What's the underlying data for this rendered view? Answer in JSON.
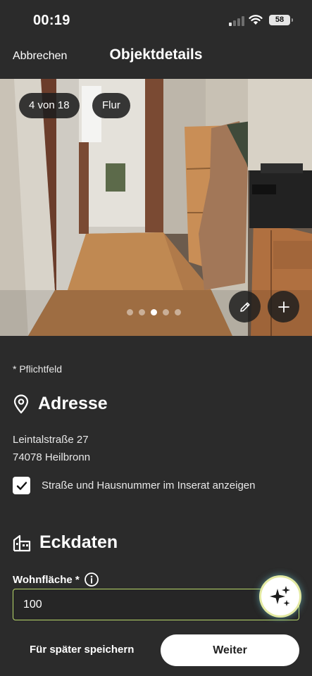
{
  "status_bar": {
    "time": "00:19",
    "battery": "58"
  },
  "nav": {
    "cancel_label": "Abbrechen",
    "title": "Objektdetails"
  },
  "photo": {
    "position_chip": "4 von 18",
    "room_chip": "Flur",
    "current_index": 4,
    "total": 18,
    "visible_dots": 5,
    "active_dot": 3
  },
  "form": {
    "required_note": "* Pflichtfeld",
    "address_section": {
      "title": "Adresse",
      "street": "Leintalstraße 27",
      "city": "74078 Heilbronn",
      "show_address_label": "Straße und Hausnummer im Inserat anzeigen",
      "show_address_checked": true
    },
    "facts_section": {
      "title": "Eckdaten",
      "living_area_label": "Wohnfläche *",
      "living_area_value": "100"
    }
  },
  "footer": {
    "save_later_label": "Für später speichern",
    "next_label": "Weiter"
  },
  "colors": {
    "background": "#2b2b2b",
    "input_border": "#b9d96a",
    "primary_button": "#ffffff"
  }
}
